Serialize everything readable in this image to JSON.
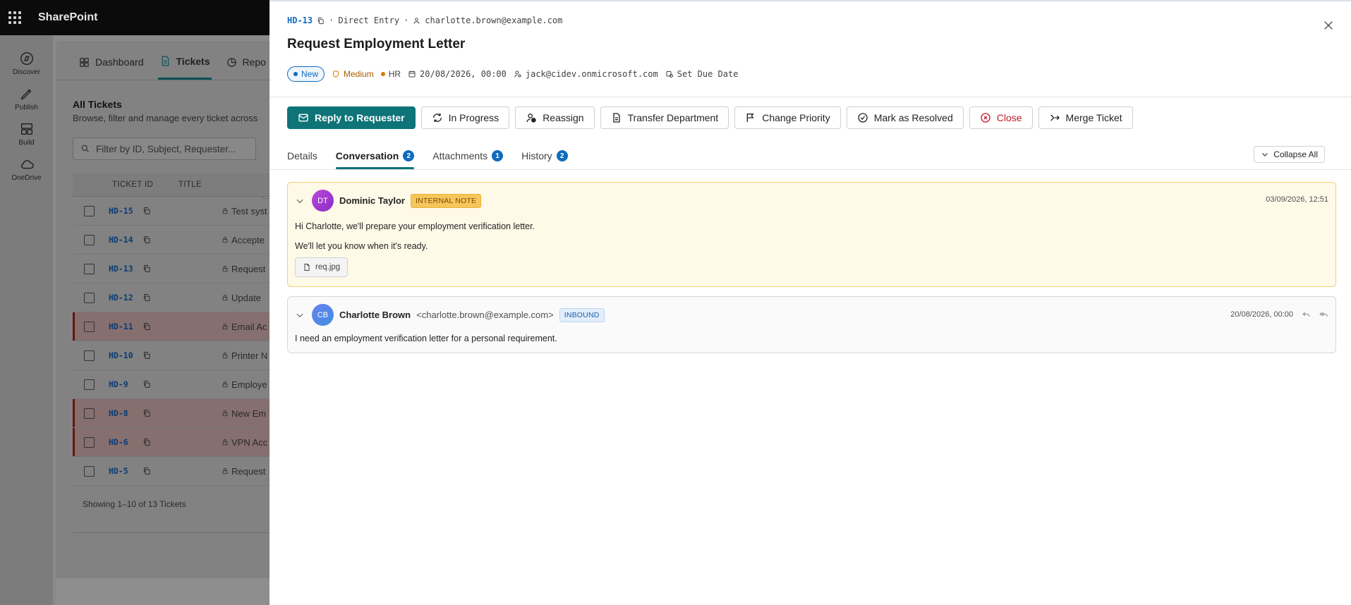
{
  "topbar": {
    "brand": "SharePoint"
  },
  "rail": [
    {
      "label": "Discover",
      "icon": "compass-icon"
    },
    {
      "label": "Publish",
      "icon": "pen-icon"
    },
    {
      "label": "Build",
      "icon": "layout-icon"
    },
    {
      "label": "OneDrive",
      "icon": "cloud-icon"
    }
  ],
  "app": {
    "tabs": [
      {
        "label": "Dashboard"
      },
      {
        "label": "Tickets"
      },
      {
        "label": "Repo"
      }
    ],
    "section_title": "All Tickets",
    "section_sub": "Browse, filter and manage every ticket across",
    "filter_placeholder": "Filter by ID, Subject, Requester...",
    "columns": {
      "id": "TICKET ID",
      "title": "TITLE"
    },
    "rows": [
      {
        "id": "HD-15",
        "title": "Test syst"
      },
      {
        "id": "HD-14",
        "title": "Accepte"
      },
      {
        "id": "HD-13",
        "title": "Request"
      },
      {
        "id": "HD-12",
        "title": "Update"
      },
      {
        "id": "HD-11",
        "title": "Email Ac"
      },
      {
        "id": "HD-10",
        "title": "Printer N"
      },
      {
        "id": "HD-9",
        "title": "Employe"
      },
      {
        "id": "HD-8",
        "title": "New Em"
      },
      {
        "id": "HD-6",
        "title": "VPN Acc"
      },
      {
        "id": "HD-5",
        "title": "Request"
      }
    ],
    "showing": "Showing 1–10 of 13 Tickets"
  },
  "panel": {
    "ticket_id": "HD-13",
    "source": "Direct Entry",
    "requester_email": "charlotte.brown@example.com",
    "title": "Request Employment Letter",
    "status": "New",
    "priority": "Medium",
    "department": "HR",
    "created": "20/08/2026, 00:00",
    "assignee": "jack@cidev.onmicrosoft.com",
    "due_date_label": "Set Due Date",
    "actions": {
      "reply": "Reply to Requester",
      "in_progress": "In Progress",
      "reassign": "Reassign",
      "transfer": "Transfer Department",
      "change_priority": "Change Priority",
      "resolve": "Mark as Resolved",
      "close": "Close",
      "merge": "Merge Ticket"
    },
    "tabs": {
      "details": "Details",
      "conversation": "Conversation",
      "conversation_count": "2",
      "attachments": "Attachments",
      "attachments_count": "1",
      "history": "History",
      "history_count": "2"
    },
    "collapse_all": "Collapse All",
    "messages": [
      {
        "initials": "DT",
        "sender": "Dominic Taylor",
        "tag": "INTERNAL NOTE",
        "time": "03/09/2026, 12:51",
        "lines": [
          "Hi Charlotte, we'll prepare your employment verification letter.",
          "We'll let you know when it's ready."
        ],
        "attachment": "req.jpg"
      },
      {
        "initials": "CB",
        "sender": "Charlotte Brown",
        "sender_email": "<charlotte.brown@example.com>",
        "tag": "INBOUND",
        "time": "20/08/2026, 00:00",
        "lines": [
          "I need an employment verification letter for a personal requirement."
        ]
      }
    ]
  },
  "colors": {
    "accent": "#0e7477",
    "link": "#0f6cbd",
    "priority": "#d97a00",
    "danger": "#c11b28"
  }
}
